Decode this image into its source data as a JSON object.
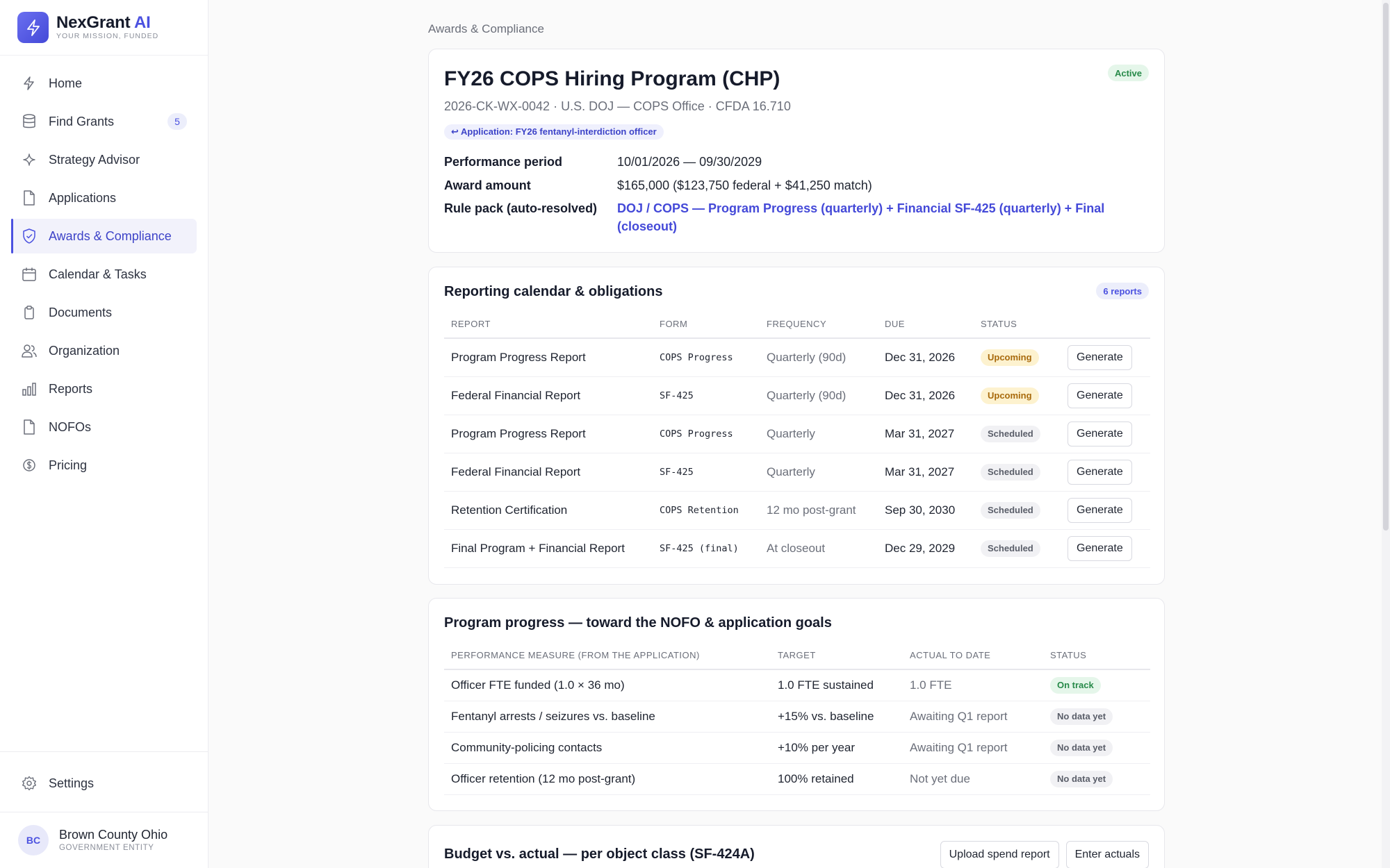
{
  "brand": {
    "name": "NexGrant",
    "name_accent": "AI",
    "tagline": "YOUR MISSION, FUNDED"
  },
  "nav": {
    "items": [
      {
        "label": "Home",
        "icon": "bolt-icon"
      },
      {
        "label": "Find Grants",
        "icon": "database-icon",
        "badge": "5"
      },
      {
        "label": "Strategy Advisor",
        "icon": "sparkle-icon"
      },
      {
        "label": "Applications",
        "icon": "file-icon"
      },
      {
        "label": "Awards & Compliance",
        "icon": "shield-check-icon",
        "active": true
      },
      {
        "label": "Calendar & Tasks",
        "icon": "calendar-icon"
      },
      {
        "label": "Documents",
        "icon": "clipboard-icon"
      },
      {
        "label": "Organization",
        "icon": "users-icon"
      },
      {
        "label": "Reports",
        "icon": "bar-chart-icon"
      },
      {
        "label": "NOFOs",
        "icon": "file-icon"
      },
      {
        "label": "Pricing",
        "icon": "dollar-icon"
      }
    ],
    "settings_label": "Settings"
  },
  "user": {
    "initials": "BC",
    "name": "Brown County Ohio",
    "role": "GOVERNMENT ENTITY"
  },
  "breadcrumb": "Awards & Compliance",
  "award": {
    "title": "FY26 COPS Hiring Program (CHP)",
    "status": "Active",
    "subtitle": "2026-CK-WX-0042 · U.S. DOJ — COPS Office · CFDA 16.710",
    "application_link": "↩ Application: FY26 fentanyl-interdiction officer",
    "performance_period_label": "Performance period",
    "performance_period": "10/01/2026 — 09/30/2029",
    "award_amount_label": "Award amount",
    "award_amount": "$165,000 ($123,750 federal + $41,250 match)",
    "rule_pack_label": "Rule pack (auto-resolved)",
    "rule_pack": "DOJ / COPS — Program Progress (quarterly) + Financial SF-425 (quarterly) + Final (closeout)"
  },
  "reporting": {
    "title": "Reporting calendar & obligations",
    "count_badge": "6 reports",
    "columns": [
      "REPORT",
      "FORM",
      "FREQUENCY",
      "DUE",
      "STATUS"
    ],
    "action_label": "Generate",
    "rows": [
      {
        "report": "Program Progress Report",
        "form": "COPS Progress",
        "frequency": "Quarterly (90d)",
        "due": "Dec 31, 2026",
        "status": "Upcoming"
      },
      {
        "report": "Federal Financial Report",
        "form": "SF-425",
        "frequency": "Quarterly (90d)",
        "due": "Dec 31, 2026",
        "status": "Upcoming"
      },
      {
        "report": "Program Progress Report",
        "form": "COPS Progress",
        "frequency": "Quarterly",
        "due": "Mar 31, 2027",
        "status": "Scheduled"
      },
      {
        "report": "Federal Financial Report",
        "form": "SF-425",
        "frequency": "Quarterly",
        "due": "Mar 31, 2027",
        "status": "Scheduled"
      },
      {
        "report": "Retention Certification",
        "form": "COPS Retention",
        "frequency": "12 mo post-grant",
        "due": "Sep 30, 2030",
        "status": "Scheduled"
      },
      {
        "report": "Final Program + Financial Report",
        "form": "SF-425 (final)",
        "frequency": "At closeout",
        "due": "Dec 29, 2029",
        "status": "Scheduled"
      }
    ]
  },
  "progress": {
    "title": "Program progress — toward the NOFO & application goals",
    "columns": [
      "PERFORMANCE MEASURE (FROM THE APPLICATION)",
      "TARGET",
      "ACTUAL TO DATE",
      "STATUS"
    ],
    "rows": [
      {
        "measure": "Officer FTE funded (1.0 × 36 mo)",
        "target": "1.0 FTE sustained",
        "actual": "1.0 FTE",
        "status": "On track"
      },
      {
        "measure": "Fentanyl arrests / seizures vs. baseline",
        "target": "+15% vs. baseline",
        "actual": "Awaiting Q1 report",
        "status": "No data yet"
      },
      {
        "measure": "Community-policing contacts",
        "target": "+10% per year",
        "actual": "Awaiting Q1 report",
        "status": "No data yet"
      },
      {
        "measure": "Officer retention (12 mo post-grant)",
        "target": "100% retained",
        "actual": "Not yet due",
        "status": "No data yet"
      }
    ]
  },
  "budget": {
    "title": "Budget vs. actual — per object class (SF-424A)",
    "upload_label": "Upload spend report",
    "enter_label": "Enter actuals"
  },
  "colors": {
    "accent": "#4b51e0",
    "active_green": "#278a49",
    "upcoming_amber": "#a86a0c"
  }
}
